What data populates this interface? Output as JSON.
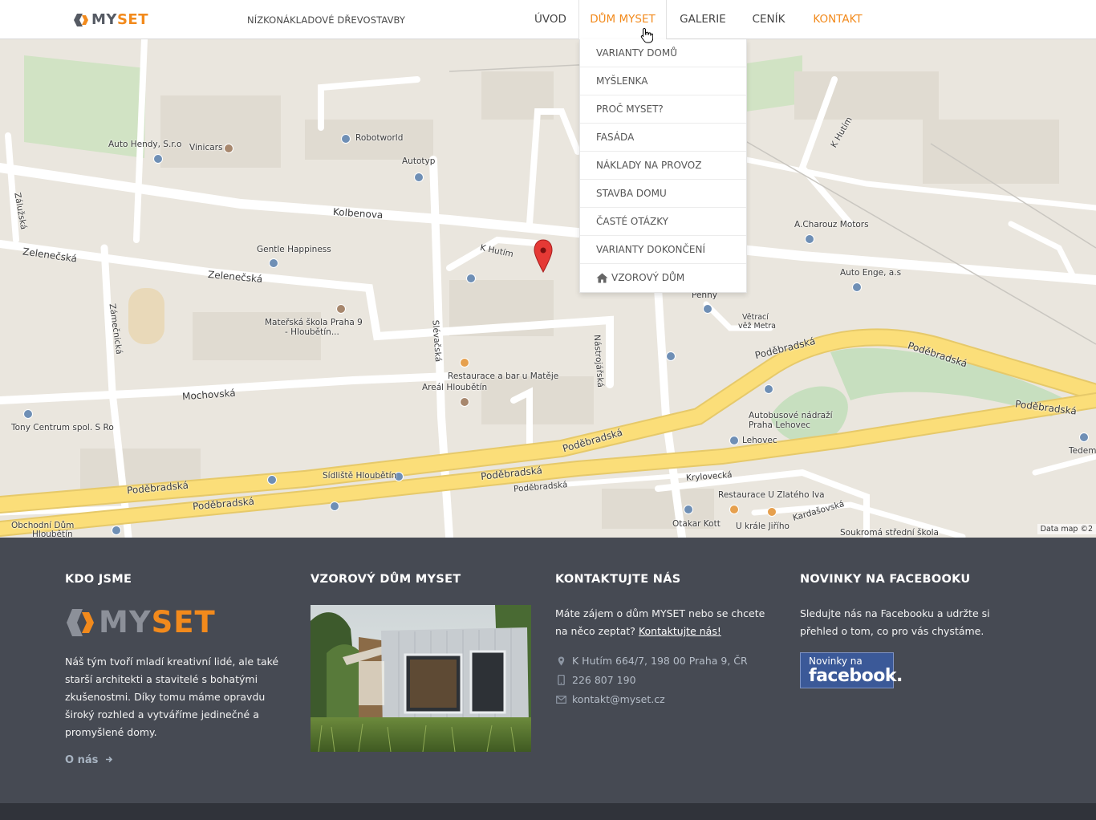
{
  "header": {
    "logo": {
      "my": "MY",
      "set": "SET"
    },
    "tagline": "NÍZKONÁKLADOVÉ DŘEVOSTAVBY",
    "nav": [
      {
        "label": "ÚVOD"
      },
      {
        "label": "DŮM MYSET"
      },
      {
        "label": "GALERIE"
      },
      {
        "label": "CENÍK"
      },
      {
        "label": "KONTAKT"
      }
    ]
  },
  "dropdown": {
    "items": [
      {
        "label": "VARIANTY DOMŮ"
      },
      {
        "label": "MYŠLENKA"
      },
      {
        "label": "PROČ MYSET?"
      },
      {
        "label": "FASÁDA"
      },
      {
        "label": "NÁKLADY NA PROVOZ"
      },
      {
        "label": "STAVBA DOMU"
      },
      {
        "label": "ČASTÉ OTÁZKY"
      },
      {
        "label": "VARIANTY DOKONČENÍ"
      },
      {
        "label": "VZOROVÝ DŮM",
        "icon": "home-icon"
      }
    ]
  },
  "map": {
    "labels": [
      "Auto Hendy, S.r.o",
      "Vinicars",
      "Robotworld",
      "Autotyp",
      "Kolbenova",
      "Zálužská",
      "Zelenečská",
      "Zelenečská",
      "Gentle Happiness",
      "K Hutím",
      "K Hutím",
      "A.Charouz Motors",
      "Auto Enge, a.s",
      "Penny",
      "Větrací",
      "věž Metra",
      "Zámečnická",
      "Mateřská škola Praha 9",
      "- Hloubětín...",
      "Slévačská",
      "Nástrojářská",
      "Restaurace a bar u Matěje",
      "Areál Hloubětín",
      "Mochovská",
      "Tony Centrum spol. S Ro",
      "Poděbradská",
      "Poděbradská",
      "Poděbradská",
      "Poděbradská",
      "Poděbradská",
      "Poděbradská",
      "Poděbradská",
      "Poděbradská",
      "Sídliště Hloubětín",
      "Autobusové nádraží",
      "Praha Lehovec",
      "Lehovec",
      "Krylovecká",
      "Restaurace U Zlatého Iva",
      "Kardašovská",
      "Otakar Kott",
      "U krále Jiřího",
      "Soukromá střední škola",
      "Obchodní Dům",
      "Hloubětín",
      "Tedem"
    ],
    "attribution": "Data map ©2"
  },
  "footer": {
    "about": {
      "title": "KDO JSME",
      "logo": {
        "my": "MY",
        "set": "SET"
      },
      "text": "Náš tým tvoří mladí kreativní lidé, ale také starší architekti a stavitelé s bohatými zkušenostmi. Díky tomu máme opravdu široký rozhled a vytváříme jedinečné a promyšlené domy.",
      "link": "O nás"
    },
    "model_house": {
      "title": "VZOROVÝ DŮM MYSET"
    },
    "contact": {
      "title": "KONTAKTUJTE NÁS",
      "intro": "Máte zájem o dům MYSET nebo se chcete na něco zeptat?",
      "intro_link": "Kontaktujte nás!",
      "address": "K Hutím 664/7, 198 00 Praha 9, ČR",
      "phone": "226 807 190",
      "email": "kontakt@myset.cz"
    },
    "facebook": {
      "title": "NOVINKY NA FACEBOOKU",
      "text": "Sledujte nás na Facebooku a udržte si přehled o tom, co pro vás chystáme.",
      "badge_small": "Novinky na",
      "badge_big": "facebook."
    }
  },
  "colors": {
    "accent": "#f28a1c",
    "footer": "#464a53",
    "footer_bottom": "#30333a",
    "facebook": "#3b5998"
  }
}
